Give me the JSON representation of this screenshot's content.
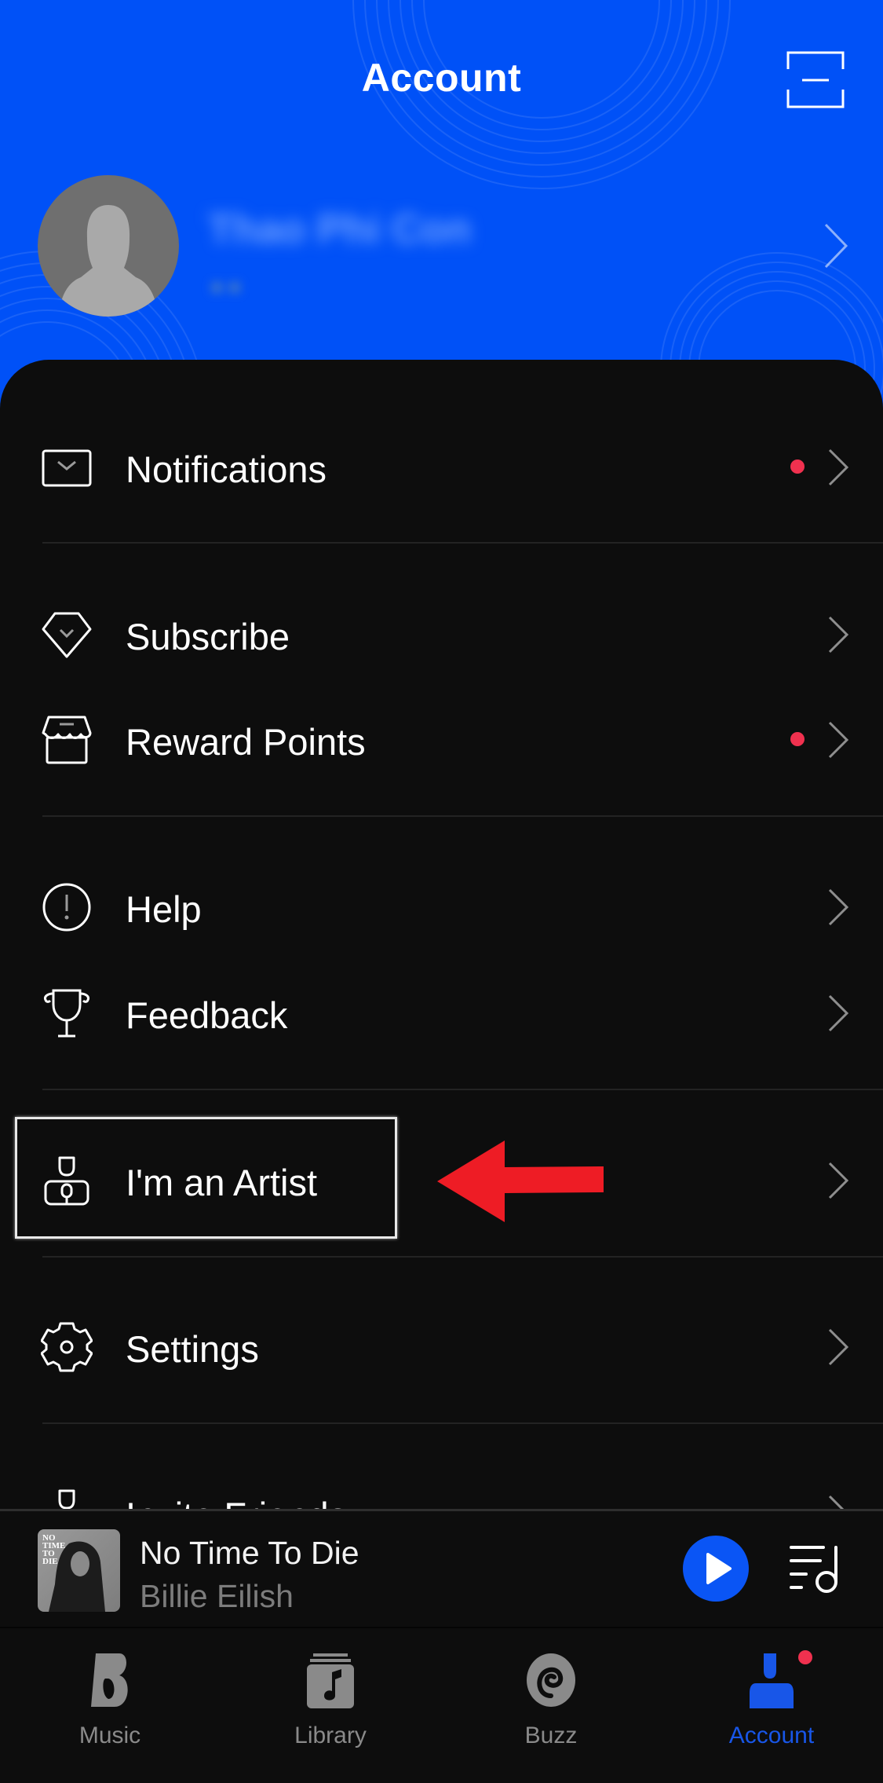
{
  "header": {
    "title": "Account",
    "scan_icon": "scan-icon",
    "profile": {
      "name": "Thao Phi Con",
      "subtitle": "• •",
      "avatar_icon": "default-avatar-icon",
      "chevron_icon": "chevron-right-icon"
    },
    "accent_color": "#0051f7"
  },
  "menu": {
    "items": [
      {
        "label": "Notifications",
        "icon": "envelope-icon",
        "has_badge": true
      },
      {
        "label": "Subscribe",
        "icon": "diamond-icon",
        "has_badge": false
      },
      {
        "label": "Reward Points",
        "icon": "store-icon",
        "has_badge": true
      },
      {
        "label": "Help",
        "icon": "info-circle-icon",
        "has_badge": false
      },
      {
        "label": "Feedback",
        "icon": "trophy-icon",
        "has_badge": false
      },
      {
        "label": "I'm an Artist",
        "icon": "artist-icon",
        "has_badge": false,
        "highlighted": true
      },
      {
        "label": "Settings",
        "icon": "gear-icon",
        "has_badge": false
      },
      {
        "label": "Invite Friends",
        "icon": "invite-icon",
        "has_badge": false
      }
    ],
    "badge_color": "#f0314f"
  },
  "annotation": {
    "arrow_color": "#ee1c25",
    "arrow_direction": "left",
    "highlight_target": "I'm an Artist"
  },
  "mini_player": {
    "title": "No Time To Die",
    "artist": "Billie Eilish",
    "cover_text": "NO TIME TO DIE",
    "play_icon": "play-icon",
    "queue_icon": "queue-icon",
    "play_button_color": "#0a55f5"
  },
  "tabbar": {
    "tabs": [
      {
        "label": "Music",
        "icon": "music-logo-icon",
        "active": false
      },
      {
        "label": "Library",
        "icon": "library-icon",
        "active": false
      },
      {
        "label": "Buzz",
        "icon": "buzz-icon",
        "active": false
      },
      {
        "label": "Account",
        "icon": "account-icon",
        "active": true,
        "has_badge": true
      }
    ],
    "active_color": "#1856e8",
    "inactive_color": "#8a8a8a"
  }
}
